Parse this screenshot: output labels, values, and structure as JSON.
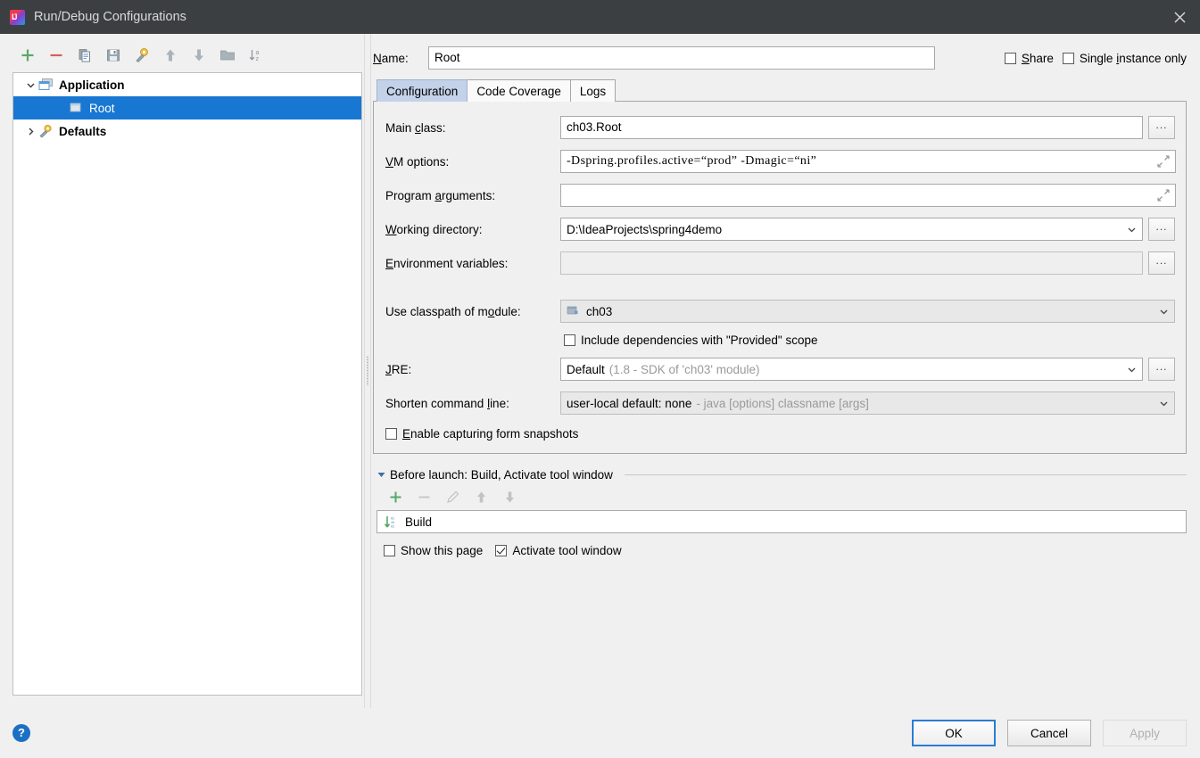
{
  "window": {
    "title": "Run/Debug Configurations",
    "app_icon": "intellij-idea-icon",
    "close_icon": "close-icon"
  },
  "tree_toolbar": {
    "buttons": [
      {
        "name": "add-configuration-button",
        "icon": "plus-icon"
      },
      {
        "name": "remove-configuration-button",
        "icon": "minus-icon"
      },
      {
        "name": "copy-configuration-button",
        "icon": "copy-icon"
      },
      {
        "name": "save-configuration-button",
        "icon": "save-icon"
      },
      {
        "name": "edit-defaults-button",
        "icon": "wrench-gear-icon"
      },
      {
        "name": "move-up-button",
        "icon": "arrow-up-icon"
      },
      {
        "name": "move-down-button",
        "icon": "arrow-down-icon"
      },
      {
        "name": "create-folder-button",
        "icon": "folder-icon"
      },
      {
        "name": "sort-configurations-button",
        "icon": "sort-az-icon"
      }
    ]
  },
  "tree": {
    "nodes": [
      {
        "label": "Application",
        "icon": "application-icon",
        "twisty": "chevron-down-icon",
        "selected": false,
        "child": false
      },
      {
        "label": "Root",
        "icon": "run-config-icon",
        "twisty": "",
        "selected": true,
        "child": true
      },
      {
        "label": "Defaults",
        "icon": "wrench-gear-icon",
        "twisty": "chevron-right-icon",
        "selected": false,
        "child": false
      }
    ]
  },
  "name_row": {
    "label": "Name:",
    "value": "Root",
    "placeholder": ""
  },
  "top_checkboxes": [
    {
      "label": "Share",
      "checked": false,
      "name": "share-checkbox"
    },
    {
      "label": "Single instance only",
      "checked": false,
      "name": "single-instance-only-checkbox"
    }
  ],
  "tabs": [
    {
      "label": "Configuration",
      "active": true,
      "name": "tab-configuration"
    },
    {
      "label": "Code Coverage",
      "active": false,
      "name": "tab-code-coverage"
    },
    {
      "label": "Logs",
      "active": false,
      "name": "tab-logs"
    }
  ],
  "fields": {
    "main_class": {
      "label": "Main class:",
      "value": "ch03.Root",
      "browse_label": "..."
    },
    "vm_options": {
      "label": "VM options:",
      "value": "-Dspring.profiles.active=“prod” -Dmagic=“ni”",
      "expand_icon": "expand-arrows-icon"
    },
    "program_arguments": {
      "label": "Program arguments:",
      "value": "",
      "expand_icon": "expand-arrows-icon"
    },
    "working_directory": {
      "label": "Working directory:",
      "value": "D:\\IdeaProjects\\spring4demo",
      "browse_label": "..."
    },
    "environment_variables": {
      "label": "Environment variables:",
      "value": "",
      "browse_label": "..."
    },
    "use_classpath_of_module": {
      "label": "Use classpath of module:",
      "value": "ch03",
      "icon": "module-icon"
    },
    "include_dependencies": {
      "label": "Include dependencies with \"Provided\" scope",
      "checked": false
    },
    "jre": {
      "label": "JRE:",
      "value": "Default",
      "value_hint": "(1.8 - SDK of 'ch03' module)",
      "browse_label": "..."
    },
    "shorten_command_line": {
      "label": "Shorten command line:",
      "value": "user-local default: none",
      "value_hint": "- java [options] classname [args]"
    },
    "enable_capturing": {
      "label": "Enable capturing form snapshots",
      "checked": false
    }
  },
  "before_launch": {
    "header": "Before launch: Build, Activate tool window",
    "twisty": "triangle-down-icon",
    "toolbar": [
      {
        "name": "add-task-button",
        "icon": "plus-icon",
        "enabled": true
      },
      {
        "name": "remove-task-button",
        "icon": "minus-icon",
        "enabled": false
      },
      {
        "name": "edit-task-button",
        "icon": "pencil-icon",
        "enabled": false
      },
      {
        "name": "move-task-up-button",
        "icon": "arrow-up-icon",
        "enabled": false
      },
      {
        "name": "move-task-down-button",
        "icon": "arrow-down-icon",
        "enabled": false
      }
    ],
    "tasks": [
      {
        "label": "Build",
        "icon": "build-icon"
      }
    ],
    "checkboxes": [
      {
        "label": "Show this page",
        "checked": false,
        "name": "show-this-page-checkbox"
      },
      {
        "label": "Activate tool window",
        "checked": true,
        "name": "activate-tool-window-checkbox"
      }
    ]
  },
  "footer": {
    "help_label": "?",
    "buttons": [
      {
        "label": "OK",
        "style": "default",
        "name": "ok-button"
      },
      {
        "label": "Cancel",
        "style": "normal",
        "name": "cancel-button"
      },
      {
        "label": "Apply",
        "style": "disabled",
        "name": "apply-button"
      }
    ]
  },
  "colors": {
    "titlebar_bg": "#3c3f41",
    "selection_blue": "#1877d2",
    "tab_active_bg": "#c3d2e9",
    "accent_blue": "#2b7cd3",
    "panel_bg": "#f0f0f0",
    "green_plus": "#5aaa5a",
    "red_minus": "#d4645a",
    "help_blue": "#1b70c4"
  }
}
